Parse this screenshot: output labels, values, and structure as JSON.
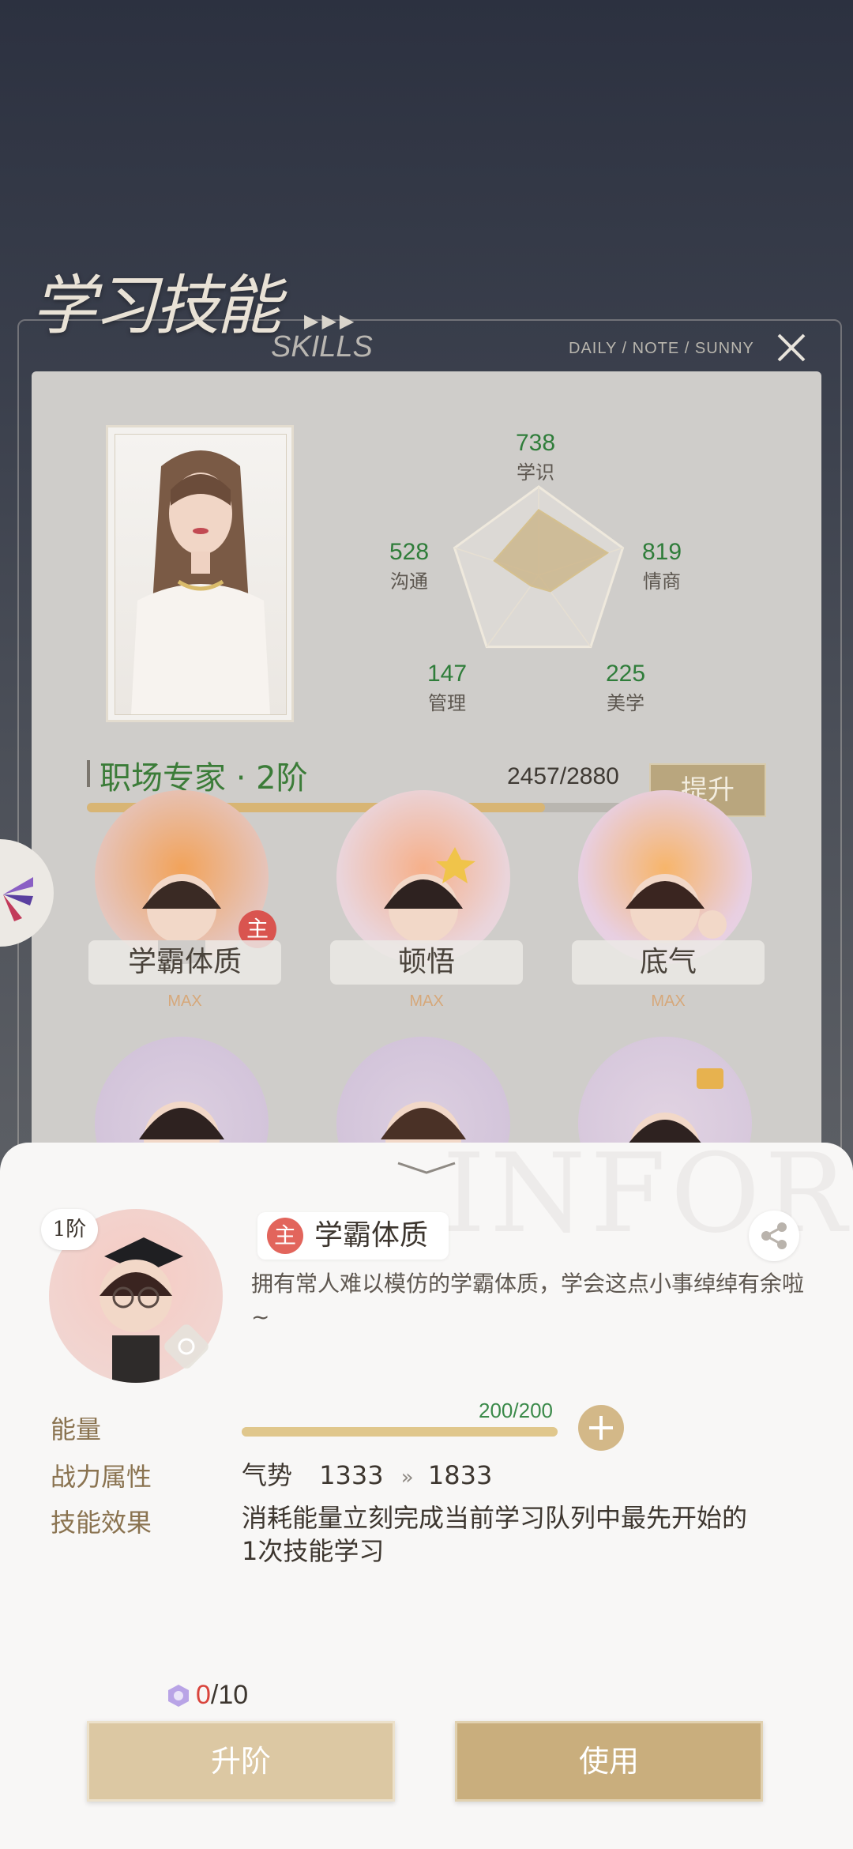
{
  "header": {
    "title_cn": "学习技能",
    "title_en": "SKILLS",
    "corner_text": "DAILY / NOTE / SUNNY",
    "close_icon": "close-icon"
  },
  "stats": {
    "top": {
      "value": "738",
      "label": "学识"
    },
    "left": {
      "value": "528",
      "label": "沟通"
    },
    "right": {
      "value": "819",
      "label": "情商"
    },
    "bl": {
      "value": "147",
      "label": "管理"
    },
    "br": {
      "value": "225",
      "label": "美学"
    }
  },
  "radar": {
    "axes": [
      "学识",
      "情商",
      "美学",
      "管理",
      "沟通"
    ],
    "values": [
      738,
      819,
      225,
      147,
      528
    ],
    "max": 1000
  },
  "career": {
    "title": "职场专家 · 2阶",
    "exp": "2457/2880",
    "progress": 0.853,
    "upgrade_label": "提升"
  },
  "skills": [
    {
      "label": "学霸体质",
      "max": "MAX",
      "main_badge": "主"
    },
    {
      "label": "顿悟",
      "max": "MAX"
    },
    {
      "label": "底气",
      "max": "MAX"
    }
  ],
  "sheet": {
    "watermark": "INFOR",
    "rank": "1阶",
    "main_badge": "主",
    "skill_name": "学霸体质",
    "description": "拥有常人难以模仿的学霸体质，学会这点小事绰绰有余啦~",
    "energy_label": "能量",
    "energy_value": "200/200",
    "energy_progress": 1.0,
    "attr_label": "战力属性",
    "attr_name": "气势",
    "attr_from": "1333",
    "attr_arrow": "»",
    "attr_to": "1833",
    "effect_label": "技能效果",
    "effect_text": "消耗能量立刻完成当前学习队列中最先开始的1次技能学习",
    "cost_current": "0",
    "cost_total": "/10",
    "btn_upgrade": "升阶",
    "btn_use": "使用"
  },
  "colors": {
    "accent_gold": "#c9ae7d",
    "stat_green": "#2f7d3a",
    "badge_red": "#d9544f"
  }
}
